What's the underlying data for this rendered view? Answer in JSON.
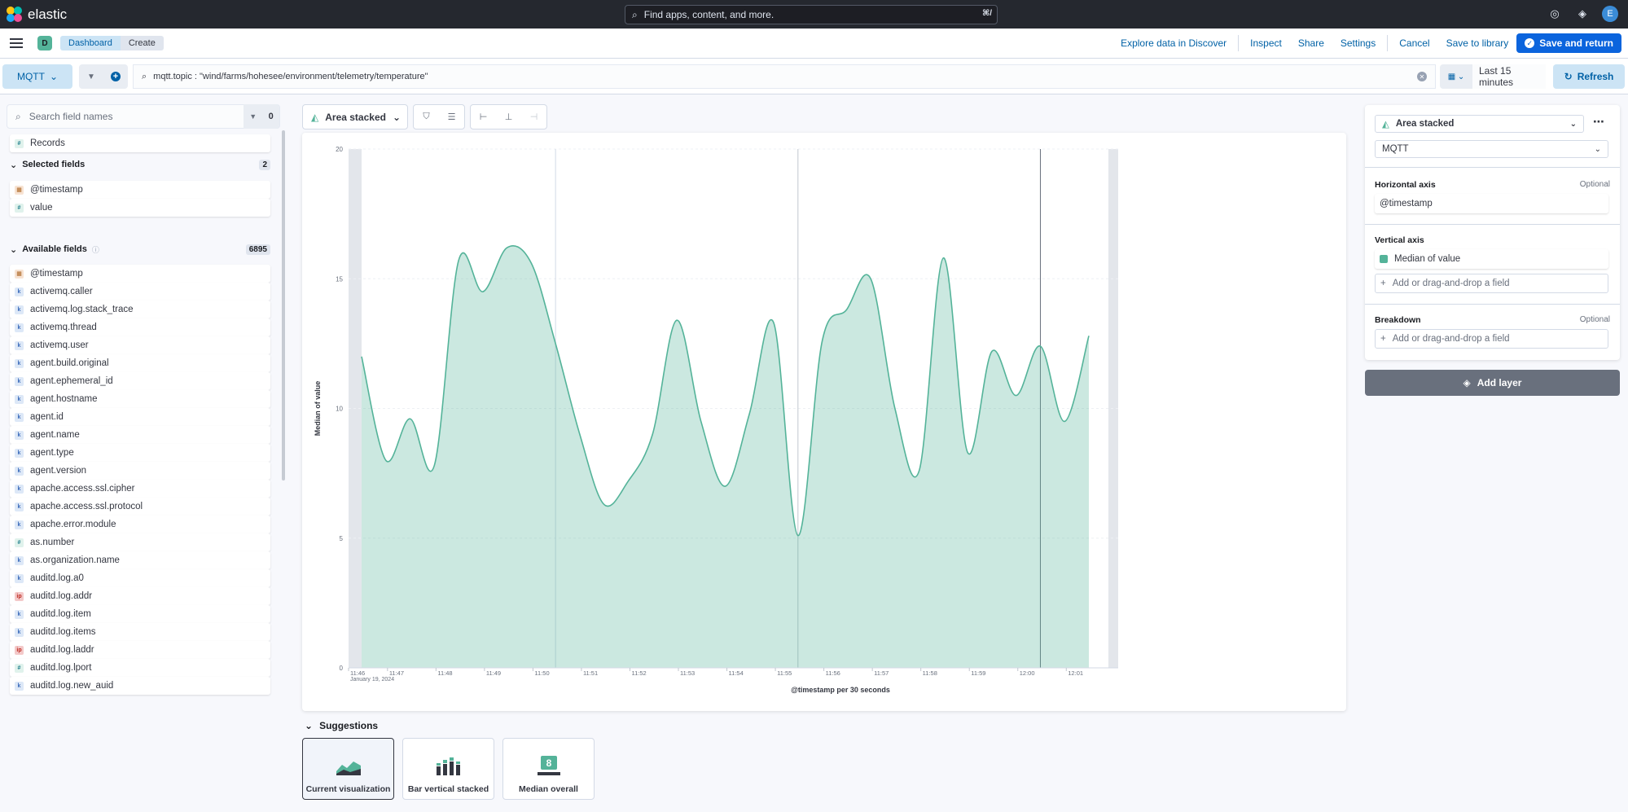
{
  "header": {
    "brand": "elastic",
    "search_placeholder": "Find apps, content, and more.",
    "search_shortcut": "⌘/",
    "avatar_initial": "E"
  },
  "breadcrumbs": {
    "space_initial": "D",
    "items": [
      "Dashboard",
      "Create"
    ]
  },
  "actions": {
    "explore": "Explore data in Discover",
    "inspect": "Inspect",
    "share": "Share",
    "settings": "Settings",
    "cancel": "Cancel",
    "save_library": "Save to library",
    "save_return": "Save and return"
  },
  "query": {
    "data_view": "MQTT",
    "kql": "mqtt.topic : \"wind/farms/hohesee/environment/telemetry/temperature\"",
    "date_range": "Last 15 minutes",
    "refresh": "Refresh"
  },
  "fields": {
    "search_placeholder": "Search field names",
    "filter_count": "0",
    "records": "Records",
    "selected_label": "Selected fields",
    "selected_count": "2",
    "selected": [
      {
        "name": "@timestamp",
        "type": "date"
      },
      {
        "name": "value",
        "type": "number"
      }
    ],
    "available_label": "Available fields",
    "available_count": "6895",
    "available": [
      {
        "name": "@timestamp",
        "type": "date"
      },
      {
        "name": "activemq.caller",
        "type": "keyword"
      },
      {
        "name": "activemq.log.stack_trace",
        "type": "keyword"
      },
      {
        "name": "activemq.thread",
        "type": "keyword"
      },
      {
        "name": "activemq.user",
        "type": "keyword"
      },
      {
        "name": "agent.build.original",
        "type": "keyword"
      },
      {
        "name": "agent.ephemeral_id",
        "type": "keyword"
      },
      {
        "name": "agent.hostname",
        "type": "keyword"
      },
      {
        "name": "agent.id",
        "type": "keyword"
      },
      {
        "name": "agent.name",
        "type": "keyword"
      },
      {
        "name": "agent.type",
        "type": "keyword"
      },
      {
        "name": "agent.version",
        "type": "keyword"
      },
      {
        "name": "apache.access.ssl.cipher",
        "type": "keyword"
      },
      {
        "name": "apache.access.ssl.protocol",
        "type": "keyword"
      },
      {
        "name": "apache.error.module",
        "type": "keyword"
      },
      {
        "name": "as.number",
        "type": "number"
      },
      {
        "name": "as.organization.name",
        "type": "keyword"
      },
      {
        "name": "auditd.log.a0",
        "type": "keyword"
      },
      {
        "name": "auditd.log.addr",
        "type": "ip"
      },
      {
        "name": "auditd.log.item",
        "type": "keyword"
      },
      {
        "name": "auditd.log.items",
        "type": "keyword"
      },
      {
        "name": "auditd.log.laddr",
        "type": "ip"
      },
      {
        "name": "auditd.log.lport",
        "type": "number"
      },
      {
        "name": "auditd.log.new_auid",
        "type": "keyword"
      }
    ]
  },
  "workspace": {
    "chart_type_label": "Area stacked"
  },
  "chart_data": {
    "type": "area",
    "ylabel": "Median of value",
    "xlabel": "@timestamp per 30 seconds",
    "date_label": "January 19, 2024",
    "ylim": [
      0,
      20
    ],
    "y_ticks": [
      0,
      5,
      10,
      15,
      20
    ],
    "x_tick_labels": [
      "11:46",
      "11:47",
      "11:48",
      "11:49",
      "11:50",
      "11:51",
      "11:52",
      "11:53",
      "11:54",
      "11:55",
      "11:56",
      "11:57",
      "11:58",
      "11:59",
      "12:00",
      "12:01"
    ],
    "x_minutes": [
      0,
      0.5,
      1,
      1.5,
      2,
      2.5,
      3,
      3.5,
      4,
      4.5,
      5,
      5.5,
      6,
      6.5,
      7,
      7.5,
      8,
      8.5,
      9,
      9.5,
      10,
      10.5,
      11,
      11.5,
      12,
      12.5,
      13,
      13.5,
      14,
      14.5,
      15
    ],
    "series": [
      {
        "name": "Median of value",
        "color": "#54b399",
        "values": [
          12.0,
          8.0,
          9.6,
          7.8,
          15.7,
          14.5,
          16.2,
          15.6,
          12.5,
          9.0,
          6.3,
          7.2,
          9.0,
          13.4,
          9.5,
          7.0,
          9.8,
          13.3,
          5.1,
          12.6,
          13.8,
          15.0,
          10.0,
          7.6,
          15.8,
          8.3,
          12.2,
          10.5,
          12.4,
          9.5,
          12.8
        ]
      }
    ],
    "gray_bands": true
  },
  "suggestions": {
    "title": "Suggestions",
    "items": [
      {
        "label": "Current visualization",
        "active": true
      },
      {
        "label": "Bar vertical stacked",
        "active": false
      },
      {
        "label": "Median overall",
        "active": false,
        "metric": "8"
      }
    ]
  },
  "config": {
    "chart_type": "Area stacked",
    "data_view": "MQTT",
    "horizontal_axis_label": "Horizontal axis",
    "optional": "Optional",
    "horizontal_field": "@timestamp",
    "vertical_axis_label": "Vertical axis",
    "vertical_field": "Median of value",
    "add_field": "Add or drag-and-drop a field",
    "breakdown_label": "Breakdown",
    "add_layer": "Add layer"
  }
}
